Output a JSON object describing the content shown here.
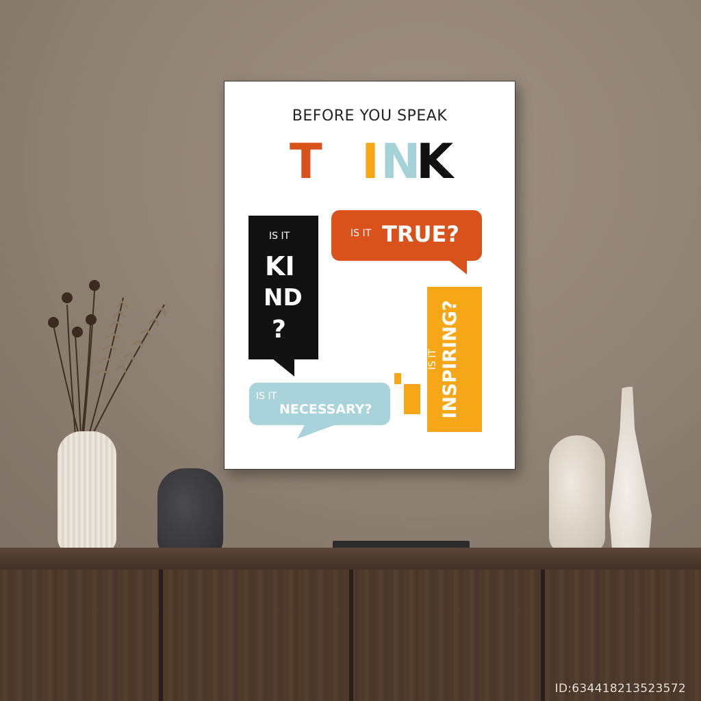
{
  "poster": {
    "headline": "BEFORE YOU SPEAK",
    "think_letters": [
      {
        "char": "T",
        "color": "#d9521b"
      },
      {
        "char": "I",
        "color": "#f5a718"
      },
      {
        "char": "N",
        "color": "#a5d2d8"
      },
      {
        "char": "K",
        "color": "#111111"
      }
    ],
    "kind": {
      "prefix": "IS IT",
      "line1": "KI",
      "line2": "ND",
      "line3": "?",
      "color": "#111111"
    },
    "true": {
      "prefix": "IS IT",
      "word": "TRUE?",
      "color": "#d9521b"
    },
    "necessary": {
      "prefix": "IS IT",
      "word": "NECESSARY?",
      "color": "#a8d3da"
    },
    "inspiring": {
      "prefix": "IS IT",
      "word": "INSPIRING?",
      "color": "#f5a718"
    }
  },
  "watermark": "ID:6344182135235​72",
  "colors": {
    "wall": "#918374",
    "shelf": "#4a382c"
  }
}
